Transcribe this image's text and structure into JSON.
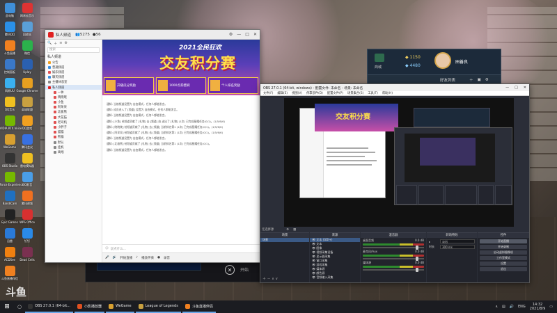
{
  "desktop": {
    "icons": [
      {
        "label": "此电脑",
        "color": "#3f8fd8"
      },
      {
        "label": "网易云音乐",
        "color": "#d33"
      },
      {
        "label": "腾讯QQ",
        "color": "#2a90e8"
      },
      {
        "label": "回收站",
        "color": "#5a9fd8"
      },
      {
        "label": "斗鱼直播",
        "color": "#f08020"
      },
      {
        "label": "微信",
        "color": "#2bb24c"
      },
      {
        "label": "控制面板",
        "color": "#3a78c8"
      },
      {
        "label": "Uplay",
        "color": "#2a60b0"
      },
      {
        "label": "网易UU",
        "color": "#3ab0f0"
      },
      {
        "label": "Google Chrome",
        "color": "#e8a020"
      },
      {
        "label": "QQ音乐",
        "color": "#f0c020"
      },
      {
        "label": "英雄联盟",
        "color": "#c8a040"
      },
      {
        "label": "NVIDIA RTX Voice",
        "color": "#76b900"
      },
      {
        "label": "QQ游戏",
        "color": "#f0a020"
      },
      {
        "label": "WeGame",
        "color": "#d8a030"
      },
      {
        "label": "腾讯会议",
        "color": "#3870e0"
      },
      {
        "label": "OBS Studio",
        "color": "#333"
      },
      {
        "label": "雷电模拟器",
        "color": "#f0c020"
      },
      {
        "label": "GeForce Experience",
        "color": "#76b900"
      },
      {
        "label": "QQ影音",
        "color": "#4a9ee8"
      },
      {
        "label": "BandiCam",
        "color": "#2070c0"
      },
      {
        "label": "腾讯视频",
        "color": "#f07020"
      },
      {
        "label": "Epic Games",
        "color": "#222"
      },
      {
        "label": "WPS Office",
        "color": "#d83030"
      },
      {
        "label": "迅雷",
        "color": "#2a7ad8"
      },
      {
        "label": "钉钉",
        "color": "#2a8ae8"
      },
      {
        "label": "ACDSee",
        "color": "#f08010"
      },
      {
        "label": "Dead Cells",
        "color": "#7a3050"
      },
      {
        "label": "斗鱼直播伴侣",
        "color": "#f08020"
      }
    ]
  },
  "chat_app": {
    "title": "私人频道",
    "members": "5275",
    "online": "56",
    "search_placeholder": "搜索",
    "group_header": "私人频道",
    "tree": [
      {
        "label": "公告",
        "color": "#f0a020"
      },
      {
        "label": "普通频道",
        "color": "#3a90e0"
      },
      {
        "label": "娱乐频道",
        "color": "#e05050"
      },
      {
        "label": "聊天频道",
        "color": "#3a90e0"
      },
      {
        "label": "主播休息室",
        "color": "#888"
      },
      {
        "label": "私人频道",
        "color": "#e02020",
        "selected": true
      },
      {
        "label": "一休",
        "color": "#e05050"
      },
      {
        "label": "晓晓晓",
        "color": "#e05050"
      },
      {
        "label": "小鱼",
        "color": "#e05050"
      },
      {
        "label": "阿呆呆",
        "color": "#e05050"
      },
      {
        "label": "北极熊",
        "color": "#e05050"
      },
      {
        "label": "大花猫",
        "color": "#e05050"
      },
      {
        "label": "老司机",
        "color": "#e05050"
      },
      {
        "label": "小胖子",
        "color": "#e05050"
      },
      {
        "label": "猫猫",
        "color": "#e05050"
      },
      {
        "label": "熊猫",
        "color": "#e05050"
      },
      {
        "label": "默认",
        "color": "#888"
      },
      {
        "label": "挂机",
        "color": "#888"
      },
      {
        "label": "离线",
        "color": "#888"
      }
    ],
    "banner": {
      "year": "2021全民狂欢",
      "headline": "交友积分赛",
      "cards": [
        {
          "title": "开播瓜分奖励"
        },
        {
          "title": "1000点券壁刷"
        },
        {
          "title": "个人排名奖励"
        }
      ]
    },
    "messages": [
      "通知: 当前频道设置为 自由模式，任何人都能发言。",
      "通知: 成员进入了 [频道] 设置为 自由模式，任何人都能发言。",
      "通知: 当前频道设置为 自由模式，任何人都能发言。",
      "通知: [小鱼] 给频道贡献了 [礼物] 去 [频道] 由 送出了 [礼物]    (1次) 已完成星耀任务(0/1)。(1/5/6/6)",
      "通知: [晓晓晓] 给频道贡献了 [礼物] 去 [频道]    当前排名第1    (1次) 已完成星耀任务(0/1)。(1/5/6/6)",
      "通知: [阿呆呆] 给频道贡献了 [礼物] 去 [频道]    当前排名第1    (1次) 已完成星耀任务(0/1)。(1/5/6/6)",
      "通知: 当前频道设置为 自由模式，任何人都能发言。",
      "通知: [北极熊] 给频道贡献了 [礼物] 去 [频道]    当前排名第1    (1次) 已完成星耀任务(0/1)。",
      "通知: 当前频道设置为 自由模式，任何人都能发言。"
    ],
    "input_placeholder": "说点什么...",
    "bottom": {
      "label1": "开始直播",
      "label2": "播放伴奏",
      "label3": "录音"
    }
  },
  "dark_window": {
    "close_glyph": "✕",
    "extra": "开始"
  },
  "profile": {
    "coins": "1150",
    "gems": "4480",
    "name": "田善良",
    "level": "商城",
    "friends_label": "好友列表"
  },
  "obs": {
    "title": "OBS 27.0.1 (64-bit, windows) - 配置文件: 未命名 - 场景: 未命名",
    "menu": [
      "文件(F)",
      "编辑(E)",
      "视图(V)",
      "停靠部件(D)",
      "配置文件(P)",
      "场景集合(S)",
      "工具(T)",
      "帮助(H)"
    ],
    "status": "无选择源",
    "scenes_header": "场景",
    "scenes": [
      "场景"
    ],
    "sources_header": "来源",
    "sources": [
      "文本 (GDI+)",
      "文本",
      "图像",
      "视频采集设备",
      "显示器采集",
      "窗口采集",
      "游戏采集",
      "媒体源",
      "颜色源",
      "音频输入采集"
    ],
    "mixer_header": "混音器",
    "mixer": [
      {
        "name": "桌面音频",
        "db": "0.0 dB"
      },
      {
        "name": "麦克风/Aux",
        "db": "0.0 dB"
      },
      {
        "name": "媒体源",
        "db": "0.0 dB"
      }
    ],
    "transitions_header": "转场特效",
    "transition_value": "淡出",
    "duration_label": "时长",
    "duration_value": "300 ms",
    "controls_header": "控件",
    "controls": [
      "开始直播",
      "开始录制",
      "启动虚拟摄像机",
      "工作室模式",
      "设置",
      "退出"
    ]
  },
  "taskbar": {
    "items": [
      {
        "label": "OBS 27.0.1 (64-bit...",
        "color": "#333"
      },
      {
        "label": "小影播放器",
        "color": "#e05020"
      },
      {
        "label": "WeGame",
        "color": "#d8a030"
      },
      {
        "label": "League of Legends",
        "color": "#c8a040"
      },
      {
        "label": "斗鱼直播伴侣",
        "color": "#f08020"
      }
    ],
    "lang": "ENG",
    "time": "14:32",
    "date": "2021/8/9"
  },
  "watermark": "斗鱼"
}
